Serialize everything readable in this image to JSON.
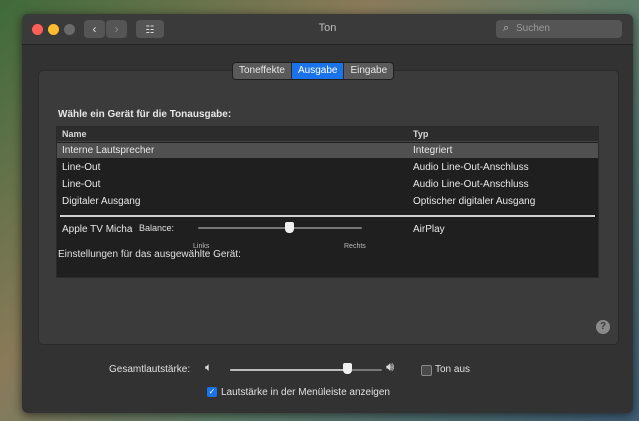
{
  "window": {
    "title": "Ton"
  },
  "search": {
    "placeholder": "Suchen"
  },
  "icons": {
    "back": "chevron-left-icon",
    "forward": "chevron-right-icon",
    "grid": "grid-icon",
    "search": "search-icon",
    "volume_low": "speaker-low-icon",
    "volume_high": "speaker-high-icon",
    "help": "help-icon",
    "check": "checkmark-icon"
  },
  "tabs": [
    {
      "label": "Toneffekte",
      "active": false
    },
    {
      "label": "Ausgabe",
      "active": true
    },
    {
      "label": "Eingabe",
      "active": false
    }
  ],
  "output": {
    "heading": "Wähle ein Gerät für die Tonausgabe:",
    "columns": {
      "name": "Name",
      "type": "Typ"
    },
    "rows": [
      {
        "name": "Interne Lautsprecher",
        "type": "Integriert",
        "selected": true
      },
      {
        "name": "Line-Out",
        "type": "Audio Line-Out-Anschluss"
      },
      {
        "name": "Line-Out",
        "type": "Audio Line-Out-Anschluss"
      },
      {
        "name": "Digitaler Ausgang",
        "type": "Optischer digitaler Ausgang"
      },
      {
        "name": "Apple TV Micha",
        "type": "AirPlay"
      }
    ]
  },
  "settings": {
    "heading": "Einstellungen für das ausgewählte Gerät:",
    "balance_label": "Balance:",
    "balance_left": "Links",
    "balance_right": "Rechts",
    "balance_value": 0.5
  },
  "volume": {
    "label": "Gesamtlautstärke:",
    "value": 0.78,
    "mute_label": "Ton aus",
    "mute_checked": false,
    "menubar_label": "Lautstärke in der Menüleiste anzeigen",
    "menubar_checked": true
  },
  "colors": {
    "accent": "#1a73e8",
    "window_bg": "#323232",
    "panel_bg": "#3b3b3b"
  }
}
